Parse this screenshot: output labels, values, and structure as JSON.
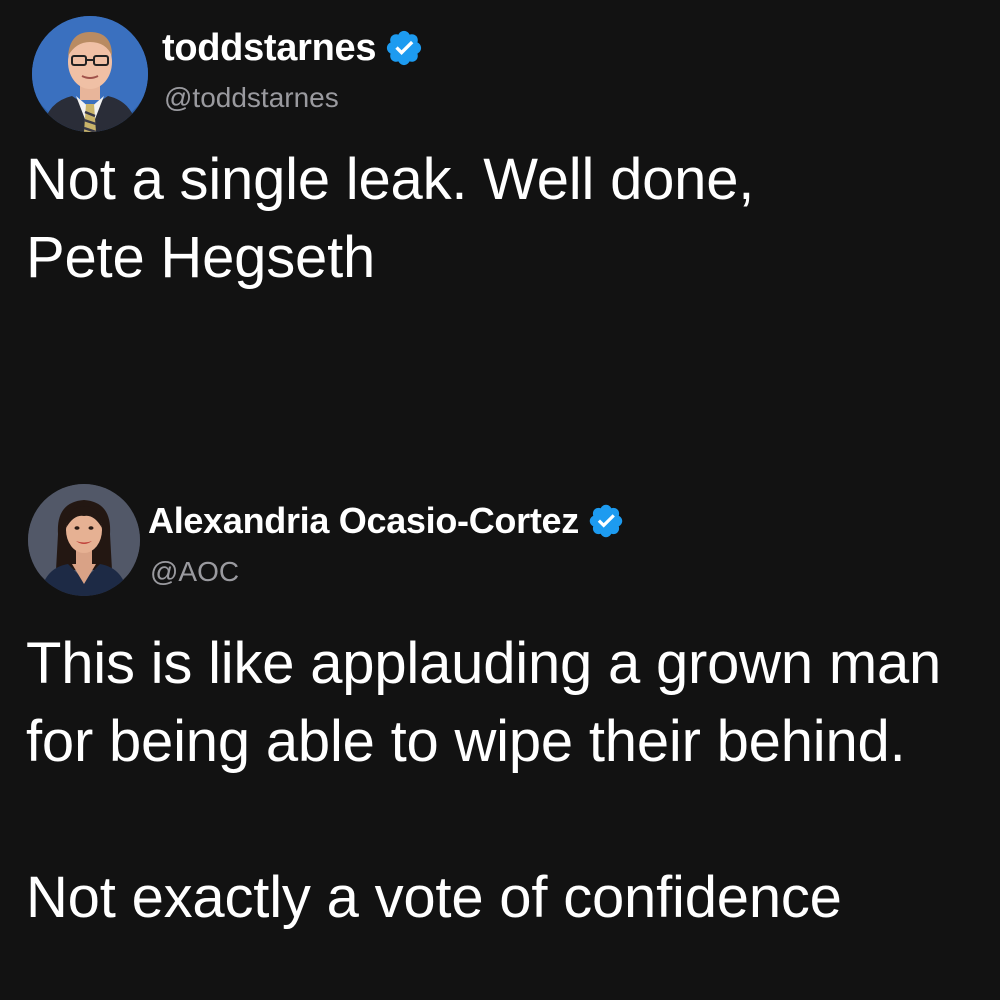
{
  "tweets": [
    {
      "display_name": "toddstarnes",
      "handle": "@toddstarnes",
      "verified": true,
      "text": "Not a single leak. Well done,\nPete Hegseth"
    },
    {
      "display_name": "Alexandria Ocasio-Cortez",
      "handle": "@AOC",
      "verified": true,
      "text": "This is like applauding a grown man\nfor being able to wipe their behind.\n\nNot exactly a vote of confidence"
    }
  ],
  "colors": {
    "background": "#121212",
    "text": "#ffffff",
    "handle": "#9a9a9f",
    "verified_badge": "#1d9bf0"
  },
  "icons": {
    "verified": "verified-badge-icon",
    "avatar": "avatar"
  }
}
